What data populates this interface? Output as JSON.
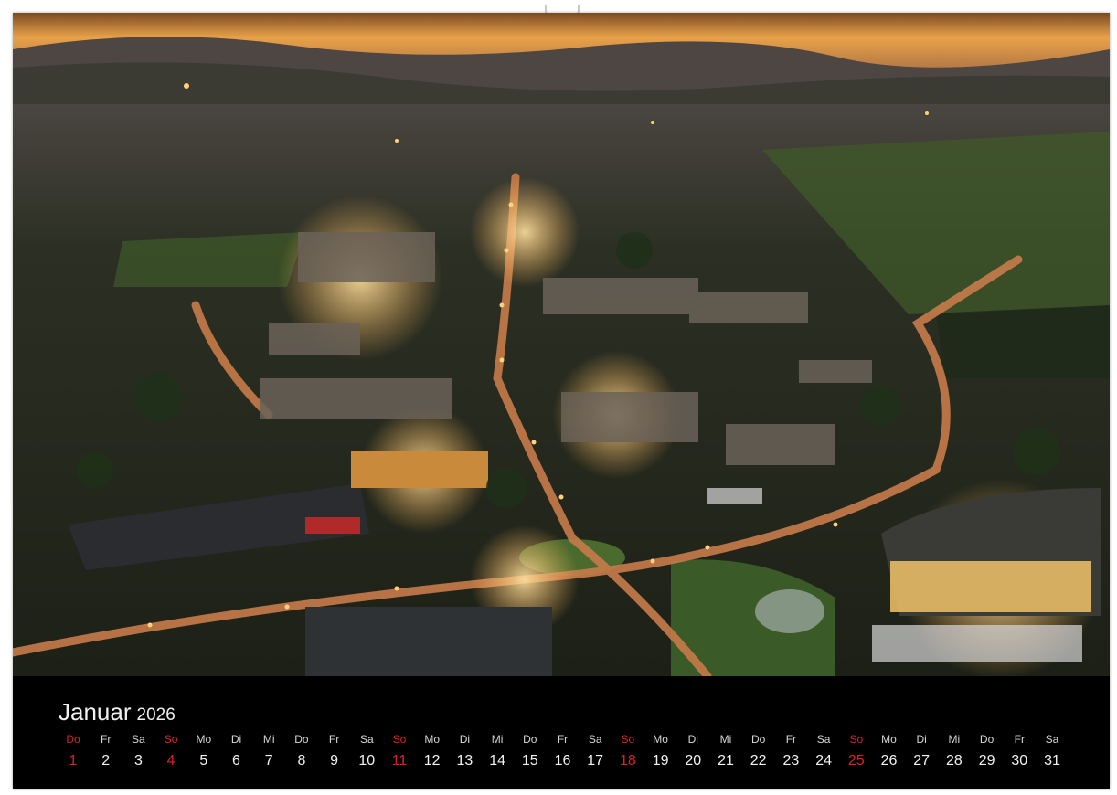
{
  "calendar": {
    "month": "Januar",
    "year": "2026",
    "image": {
      "subject": "aerial-town-at-dusk",
      "colors": {
        "sky": "#e9a24a",
        "hills": "#3a3a3e",
        "fields": "#3f5a2a",
        "roads": "#c87b4a",
        "lights": "#ffd27a"
      }
    },
    "accent": "#e02020",
    "days": [
      {
        "weekday": "Do",
        "day": "1",
        "sunday": true
      },
      {
        "weekday": "Fr",
        "day": "2",
        "sunday": false
      },
      {
        "weekday": "Sa",
        "day": "3",
        "sunday": false
      },
      {
        "weekday": "So",
        "day": "4",
        "sunday": true
      },
      {
        "weekday": "Mo",
        "day": "5",
        "sunday": false
      },
      {
        "weekday": "Di",
        "day": "6",
        "sunday": false
      },
      {
        "weekday": "Mi",
        "day": "7",
        "sunday": false
      },
      {
        "weekday": "Do",
        "day": "8",
        "sunday": false
      },
      {
        "weekday": "Fr",
        "day": "9",
        "sunday": false
      },
      {
        "weekday": "Sa",
        "day": "10",
        "sunday": false
      },
      {
        "weekday": "So",
        "day": "11",
        "sunday": true
      },
      {
        "weekday": "Mo",
        "day": "12",
        "sunday": false
      },
      {
        "weekday": "Di",
        "day": "13",
        "sunday": false
      },
      {
        "weekday": "Mi",
        "day": "14",
        "sunday": false
      },
      {
        "weekday": "Do",
        "day": "15",
        "sunday": false
      },
      {
        "weekday": "Fr",
        "day": "16",
        "sunday": false
      },
      {
        "weekday": "Sa",
        "day": "17",
        "sunday": false
      },
      {
        "weekday": "So",
        "day": "18",
        "sunday": true
      },
      {
        "weekday": "Mo",
        "day": "19",
        "sunday": false
      },
      {
        "weekday": "Di",
        "day": "20",
        "sunday": false
      },
      {
        "weekday": "Mi",
        "day": "21",
        "sunday": false
      },
      {
        "weekday": "Do",
        "day": "22",
        "sunday": false
      },
      {
        "weekday": "Fr",
        "day": "23",
        "sunday": false
      },
      {
        "weekday": "Sa",
        "day": "24",
        "sunday": false
      },
      {
        "weekday": "So",
        "day": "25",
        "sunday": true
      },
      {
        "weekday": "Mo",
        "day": "26",
        "sunday": false
      },
      {
        "weekday": "Di",
        "day": "27",
        "sunday": false
      },
      {
        "weekday": "Mi",
        "day": "28",
        "sunday": false
      },
      {
        "weekday": "Do",
        "day": "29",
        "sunday": false
      },
      {
        "weekday": "Fr",
        "day": "30",
        "sunday": false
      },
      {
        "weekday": "Sa",
        "day": "31",
        "sunday": false
      }
    ]
  }
}
